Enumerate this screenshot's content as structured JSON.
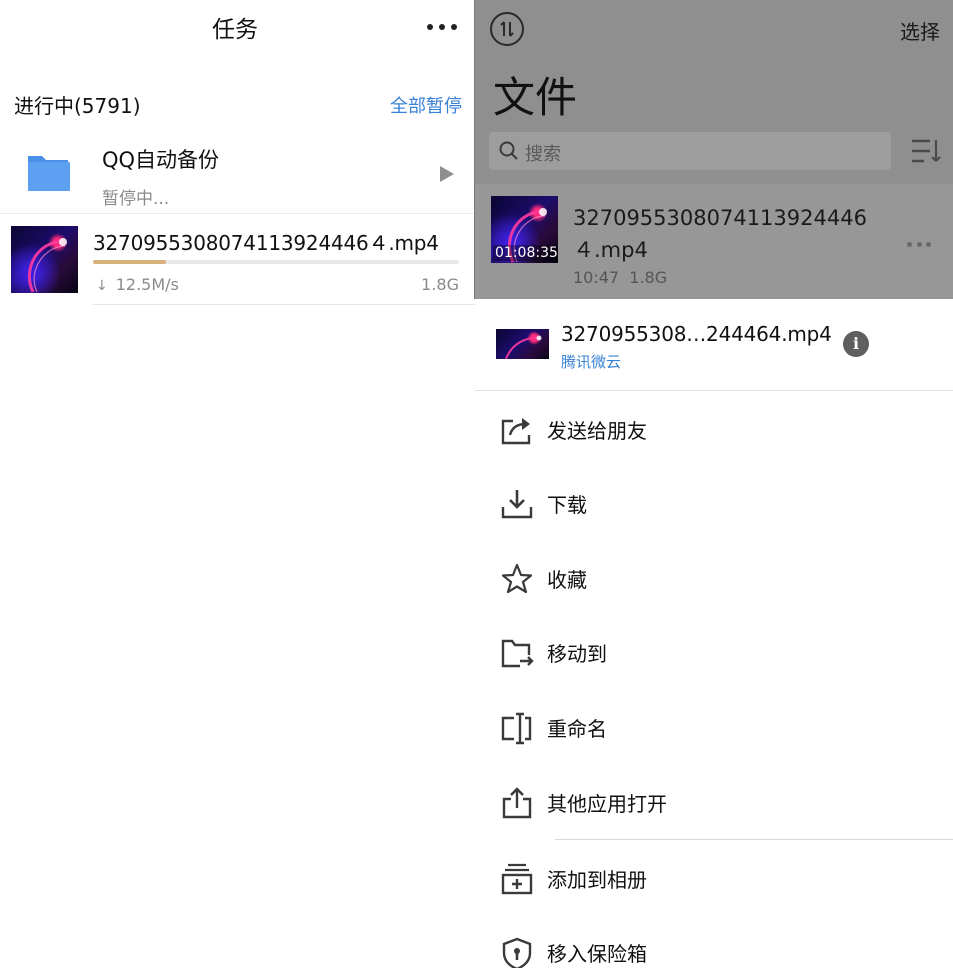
{
  "tasks": {
    "title": "任务",
    "section_title": "进行中(5791)",
    "pause_all": "全部暂停",
    "folder": {
      "name": "QQ自动备份",
      "status": "暂停中..."
    },
    "download": {
      "file_name": "3270955308074113924446４.mp4",
      "progress_fraction": 0.2,
      "speed": "12.5M/s",
      "size": "1.8G"
    }
  },
  "files": {
    "select_label": "选择",
    "title": "文件",
    "search_placeholder": "搜索",
    "file": {
      "name": "3270955308074113924446４.mp4",
      "duration": "01:08:35",
      "time": "10:47",
      "size": "1.8G"
    }
  },
  "sheet": {
    "file_name": "3270955308…244464.mp4",
    "source": "腾讯微云",
    "actions": [
      {
        "label": "发送给朋友",
        "icon": "share-icon"
      },
      {
        "label": "下载",
        "icon": "download-icon"
      },
      {
        "label": "收藏",
        "icon": "star-icon"
      },
      {
        "label": "移动到",
        "icon": "move-folder-icon"
      },
      {
        "label": "重命名",
        "icon": "rename-icon"
      },
      {
        "label": "其他应用打开",
        "icon": "open-with-icon"
      },
      {
        "label": "添加到相册",
        "icon": "add-to-album-icon"
      },
      {
        "label": "移入保险箱",
        "icon": "safe-box-icon"
      }
    ]
  },
  "colors": {
    "accent": "#3a82d6",
    "progress": "#d8b27a",
    "dim_overlay": "#8f8f8f"
  }
}
